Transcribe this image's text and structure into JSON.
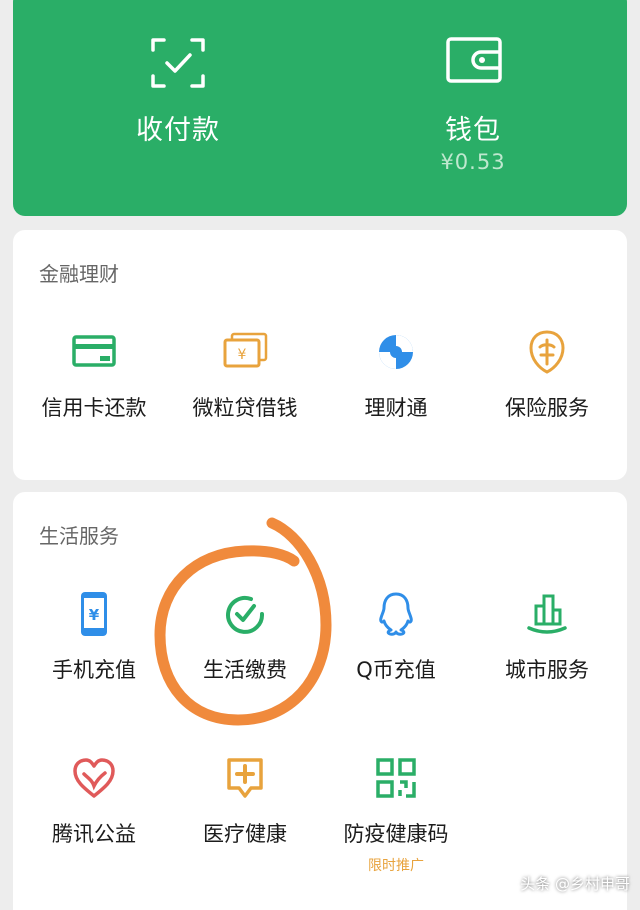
{
  "top": {
    "pay": {
      "label": "收付款",
      "icon": "scan-check-icon"
    },
    "wallet": {
      "label": "钱包",
      "balance": "¥0.53",
      "icon": "wallet-icon"
    }
  },
  "finance": {
    "title": "金融理财",
    "items": [
      {
        "label": "信用卡还款",
        "icon": "credit-card-icon"
      },
      {
        "label": "微粒贷借钱",
        "icon": "loan-yen-icon"
      },
      {
        "label": "理财通",
        "icon": "licaitong-icon"
      },
      {
        "label": "保险服务",
        "icon": "insurance-icon"
      }
    ]
  },
  "life": {
    "title": "生活服务",
    "items": [
      {
        "label": "手机充值",
        "icon": "phone-topup-icon"
      },
      {
        "label": "生活缴费",
        "icon": "utility-payment-icon"
      },
      {
        "label": "Q币充值",
        "icon": "qq-coin-icon"
      },
      {
        "label": "城市服务",
        "icon": "city-service-icon"
      },
      {
        "label": "腾讯公益",
        "icon": "charity-heart-icon"
      },
      {
        "label": "医疗健康",
        "icon": "medical-icon"
      },
      {
        "label": "防疫健康码",
        "icon": "qr-code-icon",
        "badge": "限时推广"
      }
    ]
  },
  "colors": {
    "green": "#2aae67",
    "orange": "#e8a33d",
    "blue": "#2f8ee8",
    "red": "#e05a5a",
    "annotation": "#f08a3c"
  },
  "watermark": "头条 @乡村申哥"
}
